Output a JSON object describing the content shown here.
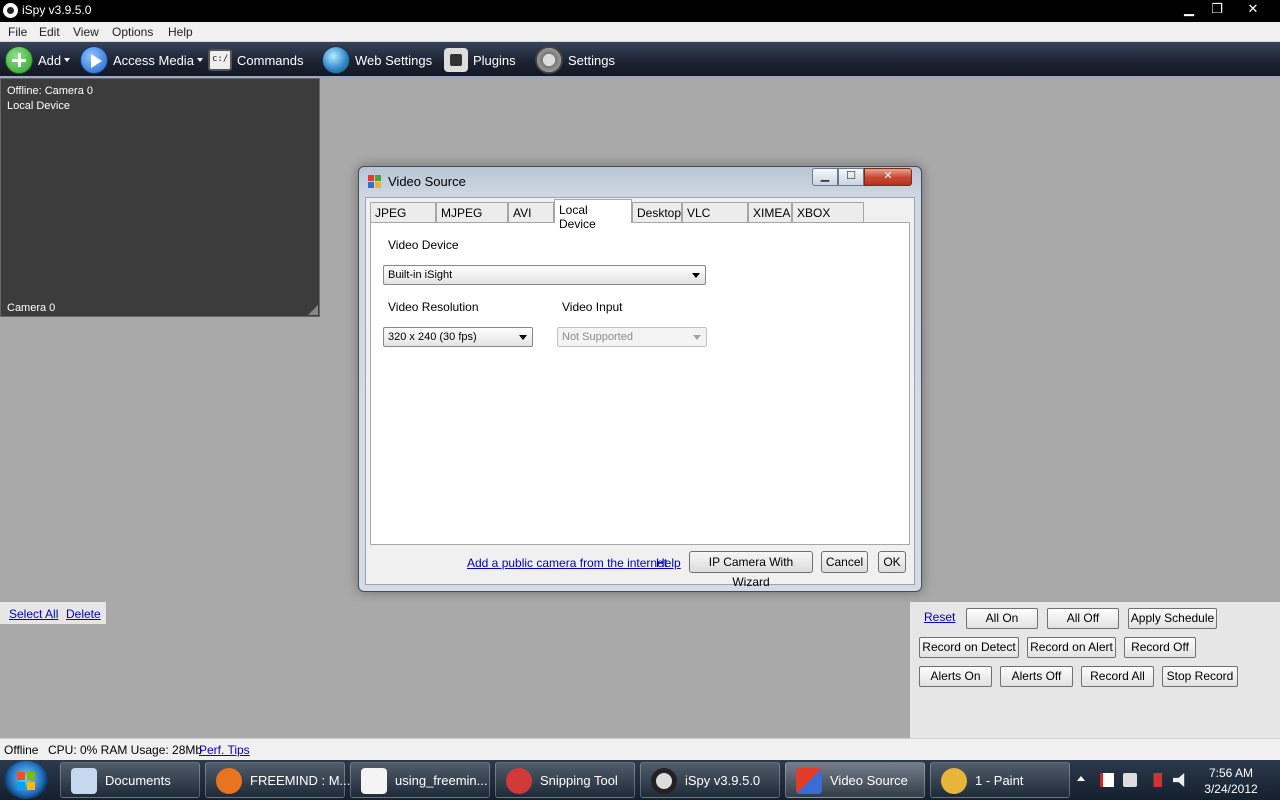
{
  "window": {
    "title": "iSpy v3.9.5.0",
    "min": "▁",
    "max": "❐",
    "close": "✕"
  },
  "menu": [
    "File",
    "Edit",
    "View",
    "Options",
    "Help"
  ],
  "toolbar": {
    "add": "Add",
    "access_media": "Access Media",
    "commands": "Commands",
    "web_settings": "Web Settings",
    "plugins": "Plugins",
    "settings": "Settings"
  },
  "camera_panel": {
    "status_line1": "Offline: Camera 0",
    "status_line2": "Local Device",
    "name": "Camera 0"
  },
  "dialog": {
    "title": "Video Source",
    "tabs": [
      "JPEG URL",
      "MJPEG URL",
      "AVI File",
      "Local Device",
      "Desktop",
      "VLC Plugin",
      "XIMEA",
      "XBOX Kinect"
    ],
    "active_tab": "Local Device",
    "video_device_label": "Video Device",
    "video_device_value": "Built-in iSight",
    "video_resolution_label": "Video Resolution",
    "video_resolution_value": "320 x 240 (30 fps)",
    "video_input_label": "Video Input",
    "video_input_value": "Not Supported",
    "add_public_camera": "Add a public camera from the internet",
    "help": "Help",
    "ip_camera_wizard": "IP Camera With Wizard",
    "cancel": "Cancel",
    "ok": "OK"
  },
  "grid_toolbar": {
    "select_all": "Select All",
    "delete": "Delete"
  },
  "right_panel": {
    "reset": "Reset",
    "all_on": "All On",
    "all_off": "All Off",
    "apply_schedule": "Apply Schedule",
    "record_on_detect": "Record on Detect",
    "record_on_alert": "Record on Alert",
    "record_off": "Record Off",
    "alerts_on": "Alerts On",
    "alerts_off": "Alerts Off",
    "record_all": "Record All",
    "stop_record": "Stop Record"
  },
  "statusbar": {
    "status": "Offline",
    "usage": "CPU: 0% RAM Usage: 28Mb",
    "perf_tips": "Perf. Tips"
  },
  "taskbar": {
    "items": [
      {
        "label": "Documents",
        "icon": "documents-icon",
        "color": "#c7d8ee"
      },
      {
        "label": "FREEMIND : M...",
        "icon": "firefox-icon",
        "color": "#e8741f"
      },
      {
        "label": "using_freemin...",
        "icon": "editor-icon",
        "color": "#f4f4f4"
      },
      {
        "label": "Snipping Tool",
        "icon": "scissors-icon",
        "color": "#d23a3a"
      },
      {
        "label": "iSpy v3.9.5.0",
        "icon": "ispy-eye-icon",
        "color": "#222222"
      },
      {
        "label": "Video Source",
        "icon": "video-source-icon",
        "color": "#3b6cd6"
      },
      {
        "label": "1 - Paint",
        "icon": "paint-icon",
        "color": "#e6b53a"
      }
    ],
    "time": "7:56 AM",
    "date": "3/24/2012"
  }
}
